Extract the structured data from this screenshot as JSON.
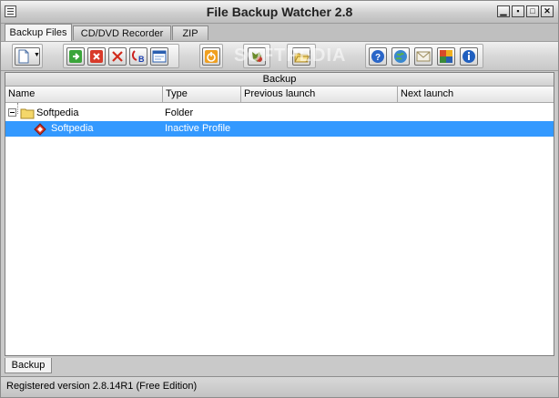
{
  "window": {
    "title": "File Backup Watcher 2.8",
    "controls": [
      "minimize-icon",
      "maximize-icon",
      "restore-icon",
      "close-icon"
    ]
  },
  "tabs": [
    {
      "label": "Backup Files",
      "active": true
    },
    {
      "label": "CD/DVD Recorder",
      "active": false
    },
    {
      "label": "ZIP",
      "active": false
    }
  ],
  "toolbar": {
    "watermark": "SOFTPEDIA",
    "buttons": [
      "new-profile-icon",
      "dropdown-arrow-icon",
      "run-icon",
      "stop-icon",
      "delete-icon",
      "backup-restore-icon",
      "schedule-window-icon",
      "power-icon",
      "tree-add-icon",
      "open-folder-icon",
      "help-icon",
      "web-icon",
      "mail-icon",
      "tools-icon",
      "info-icon"
    ]
  },
  "panel": {
    "header": "Backup",
    "columns": [
      "Name",
      "Type",
      "Previous launch",
      "Next launch"
    ],
    "rows": [
      {
        "name": "Softpedia",
        "type": "Folder",
        "previous": "",
        "next": "",
        "icon": "folder-icon",
        "selected": false
      },
      {
        "name": "Softpedia",
        "type": "Inactive Profile",
        "previous": "",
        "next": "",
        "icon": "profile-icon",
        "selected": true
      }
    ]
  },
  "bottom_tab": {
    "label": "Backup"
  },
  "status": {
    "text": "Registered version 2.8.14R1 (Free Edition)"
  },
  "colors": {
    "selection": "#3399ff",
    "window_bg": "#c9c9c9"
  }
}
